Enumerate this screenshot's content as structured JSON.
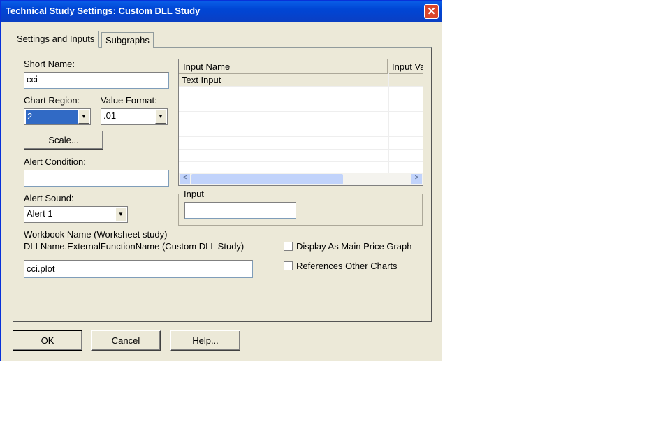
{
  "window": {
    "title": "Technical Study Settings: Custom DLL Study",
    "close": "✕"
  },
  "tabs": [
    {
      "label": "Settings and Inputs"
    },
    {
      "label": "Subgraphs"
    }
  ],
  "form": {
    "short_name_label": "Short Name:",
    "short_name_value": "cci",
    "chart_region_label": "Chart Region:",
    "chart_region_value": "2",
    "value_format_label": "Value Format:",
    "value_format_value": ".01",
    "scale_button": "Scale...",
    "alert_condition_label": "Alert Condition:",
    "alert_condition_value": "",
    "alert_sound_label": "Alert Sound:",
    "alert_sound_value": "Alert 1",
    "workbook_label": "Workbook Name (Worksheet study)",
    "dll_label": "DLLName.ExternalFunctionName (Custom DLL Study)",
    "dll_value": "cci.plot"
  },
  "grid": {
    "columns": [
      "Input Name",
      "Input Va"
    ],
    "rows": [
      [
        "Text Input",
        ""
      ]
    ]
  },
  "input_group": {
    "label": "Input",
    "value": ""
  },
  "checkboxes": [
    {
      "label": "Display As Main Price Graph",
      "checked": false
    },
    {
      "label": "References Other Charts",
      "checked": false
    }
  ],
  "buttons": {
    "ok": "OK",
    "cancel": "Cancel",
    "help": "Help..."
  }
}
